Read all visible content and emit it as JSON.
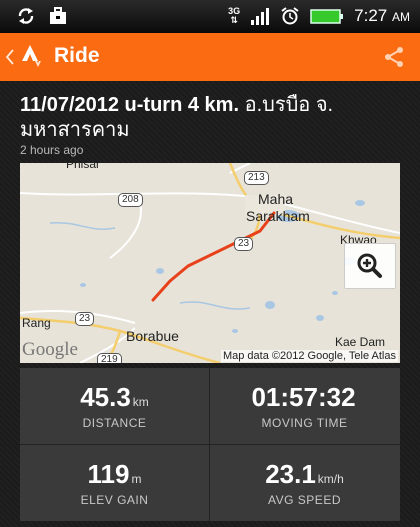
{
  "status_bar": {
    "time": "7:27",
    "time_suffix": "AM",
    "network": "3G"
  },
  "action_bar": {
    "title": "Ride"
  },
  "activity": {
    "title_bold": "11/07/2012  u-turn 4 km.",
    "title_location": " อ.บรบือ จ.",
    "title_line2": "มหาสารคาม",
    "time_ago": "2 hours ago"
  },
  "map": {
    "labels": {
      "maha": "Maha",
      "sarakham": "Sarakham",
      "khwao": "Khwao",
      "rang": "Rang",
      "borabue": "Borabue",
      "kae_dam": "Kae Dam",
      "phisai": "Phisai"
    },
    "route_shields": {
      "r213": "213",
      "r208": "208",
      "r23a": "23",
      "r23b": "23",
      "r219": "219"
    },
    "google_logo": "Google",
    "attribution": "Map data ©2012 Google, Tele Atlas"
  },
  "stats": [
    {
      "value": "45.3",
      "unit": "km",
      "label": "DISTANCE"
    },
    {
      "value": "01:57:32",
      "unit": "",
      "label": "MOVING TIME"
    },
    {
      "value": "119",
      "unit": "m",
      "label": "ELEV GAIN"
    },
    {
      "value": "23.1",
      "unit": "km/h",
      "label": "AVG SPEED"
    }
  ],
  "colors": {
    "accent": "#fa6b12",
    "route": "#e8401a",
    "stats_bg": "#3a3a3a"
  },
  "icons": {
    "status_left": [
      "sync-icon",
      "briefcase-icon"
    ],
    "status_right": [
      "network-3g-icon",
      "signal-icon",
      "alarm-icon",
      "battery-icon"
    ],
    "action_bar": [
      "back-chevron-icon",
      "strava-logo-icon",
      "share-icon"
    ],
    "map": [
      "zoom-in-icon"
    ]
  }
}
